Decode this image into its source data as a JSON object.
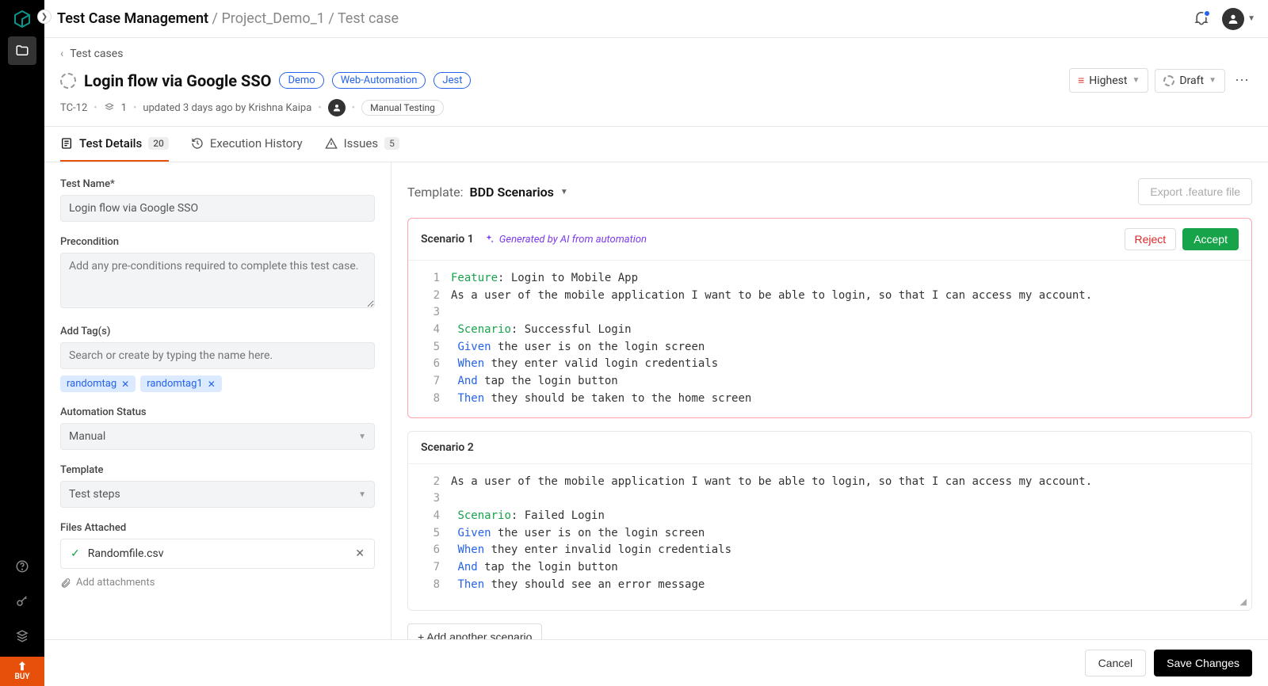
{
  "breadcrumb": {
    "root": "Test Case Management",
    "project": "Project_Demo_1",
    "page": "Test case"
  },
  "back_link": "Test cases",
  "title": "Login flow via Google SSO",
  "pills": [
    "Demo",
    "Web-Automation",
    "Jest"
  ],
  "priority_label": "Highest",
  "status_label": "Draft",
  "meta": {
    "id": "TC-12",
    "stack_count": "1",
    "updated": "updated 3 days ago by Krishna Kaipa",
    "type": "Manual Testing"
  },
  "tabs": {
    "details": {
      "label": "Test Details",
      "count": "20"
    },
    "history": {
      "label": "Execution History"
    },
    "issues": {
      "label": "Issues",
      "count": "5"
    }
  },
  "form": {
    "name_label": "Test Name*",
    "name_value": "Login flow via Google SSO",
    "precondition_label": "Precondition",
    "precondition_placeholder": "Add any pre-conditions required to complete this test case.",
    "tags_label": "Add Tag(s)",
    "tags_placeholder": "Search or create by typing the name here.",
    "tags": [
      "randomtag",
      "randomtag1"
    ],
    "automation_label": "Automation Status",
    "automation_value": "Manual",
    "template_label": "Template",
    "template_value": "Test steps",
    "files_label": "Files Attached",
    "file_name": "Randomfile.csv",
    "attach_link": "Add attachments"
  },
  "template_row": {
    "label": "Template:",
    "value": "BDD Scenarios",
    "export": "Export .feature file"
  },
  "scenario1": {
    "title": "Scenario 1",
    "ai_note": "Generated by AI from automation",
    "reject": "Reject",
    "accept": "Accept",
    "lines": [
      {
        "n": "1",
        "seg": [
          {
            "c": "kw-feature",
            "t": "Feature"
          },
          {
            "t": ": Login to Mobile App"
          }
        ]
      },
      {
        "n": "2",
        "seg": [
          {
            "t": "As a user of the mobile application I want to be able to login, so that I can access my account."
          }
        ]
      },
      {
        "n": "3",
        "seg": [
          {
            "t": ""
          }
        ]
      },
      {
        "n": "4",
        "seg": [
          {
            "t": " "
          },
          {
            "c": "kw-scenario",
            "t": "Scenario"
          },
          {
            "t": ": Successful Login"
          }
        ]
      },
      {
        "n": "5",
        "seg": [
          {
            "t": " "
          },
          {
            "c": "kw-step",
            "t": "Given"
          },
          {
            "t": " the user is on the login screen"
          }
        ]
      },
      {
        "n": "6",
        "seg": [
          {
            "t": " "
          },
          {
            "c": "kw-step",
            "t": "When"
          },
          {
            "t": " they enter valid login credentials"
          }
        ]
      },
      {
        "n": "7",
        "seg": [
          {
            "t": " "
          },
          {
            "c": "kw-step",
            "t": "And"
          },
          {
            "t": " tap the login button"
          }
        ]
      },
      {
        "n": "8",
        "seg": [
          {
            "t": " "
          },
          {
            "c": "kw-step",
            "t": "Then"
          },
          {
            "t": " they should be taken to the home screen"
          }
        ]
      }
    ]
  },
  "scenario2": {
    "title": "Scenario 2",
    "lines": [
      {
        "n": "2",
        "seg": [
          {
            "t": "As a user of the mobile application I want to be able to login, so that I can access my account."
          }
        ]
      },
      {
        "n": "3",
        "seg": [
          {
            "t": ""
          }
        ]
      },
      {
        "n": "4",
        "seg": [
          {
            "t": " "
          },
          {
            "c": "kw-scenario",
            "t": "Scenario"
          },
          {
            "t": ": Failed Login"
          }
        ]
      },
      {
        "n": "5",
        "seg": [
          {
            "t": " "
          },
          {
            "c": "kw-step",
            "t": "Given"
          },
          {
            "t": " the user is on the login screen"
          }
        ]
      },
      {
        "n": "6",
        "seg": [
          {
            "t": " "
          },
          {
            "c": "kw-step",
            "t": "When"
          },
          {
            "t": " they enter invalid login credentials"
          }
        ]
      },
      {
        "n": "7",
        "seg": [
          {
            "t": " "
          },
          {
            "c": "kw-step",
            "t": "And"
          },
          {
            "t": " tap the login button"
          }
        ]
      },
      {
        "n": "8",
        "seg": [
          {
            "t": " "
          },
          {
            "c": "kw-step",
            "t": "Then"
          },
          {
            "t": " they should see an error message"
          }
        ]
      }
    ]
  },
  "add_scenario": "+ Add another scenario",
  "footer": {
    "cancel": "Cancel",
    "save": "Save Changes"
  },
  "buy": "BUY"
}
